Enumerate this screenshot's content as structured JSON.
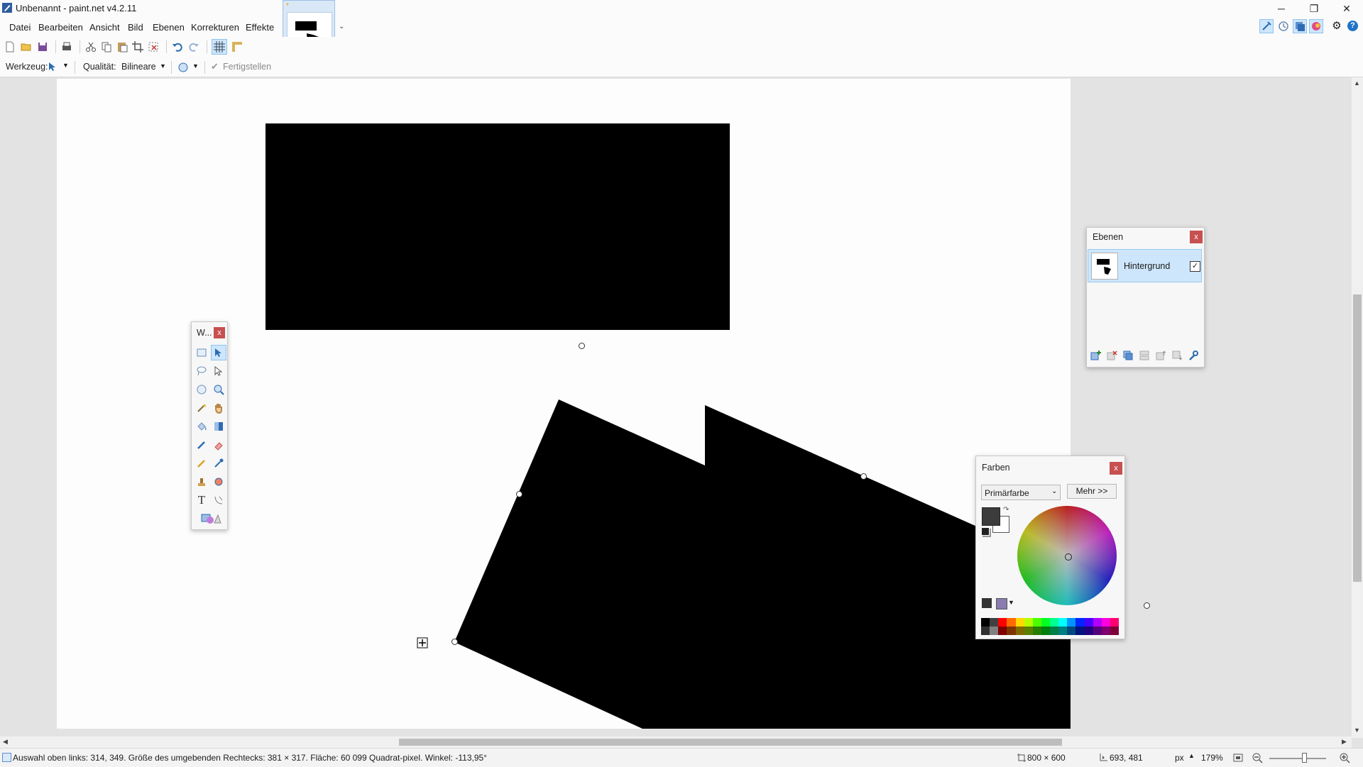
{
  "window": {
    "title": "Unbenannt - paint.net v4.2.11",
    "minimize": "─",
    "maximize": "❐",
    "close": "✕"
  },
  "menu": {
    "items": [
      "Datei",
      "Bearbeiten",
      "Ansicht",
      "Bild",
      "Ebenen",
      "Korrekturen",
      "Effekte"
    ]
  },
  "tool_options": {
    "tool_label": "Werkzeug:",
    "quality_label": "Qualität:",
    "quality_value": "Bilineare",
    "finish_label": "Fertigstellen"
  },
  "tools_window": {
    "title": "W...",
    "close": "x"
  },
  "layers_window": {
    "title": "Ebenen",
    "close": "x",
    "layers": [
      {
        "name": "Hintergrund",
        "visible": true
      }
    ]
  },
  "colors_window": {
    "title": "Farben",
    "close": "x",
    "mode": "Primärfarbe",
    "more_button": "Mehr >>",
    "primary_color": "#3c3c3c",
    "secondary_color": "#ffffff"
  },
  "status": {
    "selection_info": "Auswahl oben links: 314, 349. Größe des umgebenden Rechtecks: 381 × 317. Fläche: 60 099 Quadrat-pixel. Winkel: -113,95°",
    "image_size": "800 × 600",
    "cursor_position": "693, 481",
    "unit": "px",
    "zoom": "179%"
  },
  "colors": {
    "accent": "#0078d7",
    "shape_fill": "#000000",
    "canvas_bg": "#fdfdfd",
    "workspace_bg": "#e3e3e3"
  }
}
